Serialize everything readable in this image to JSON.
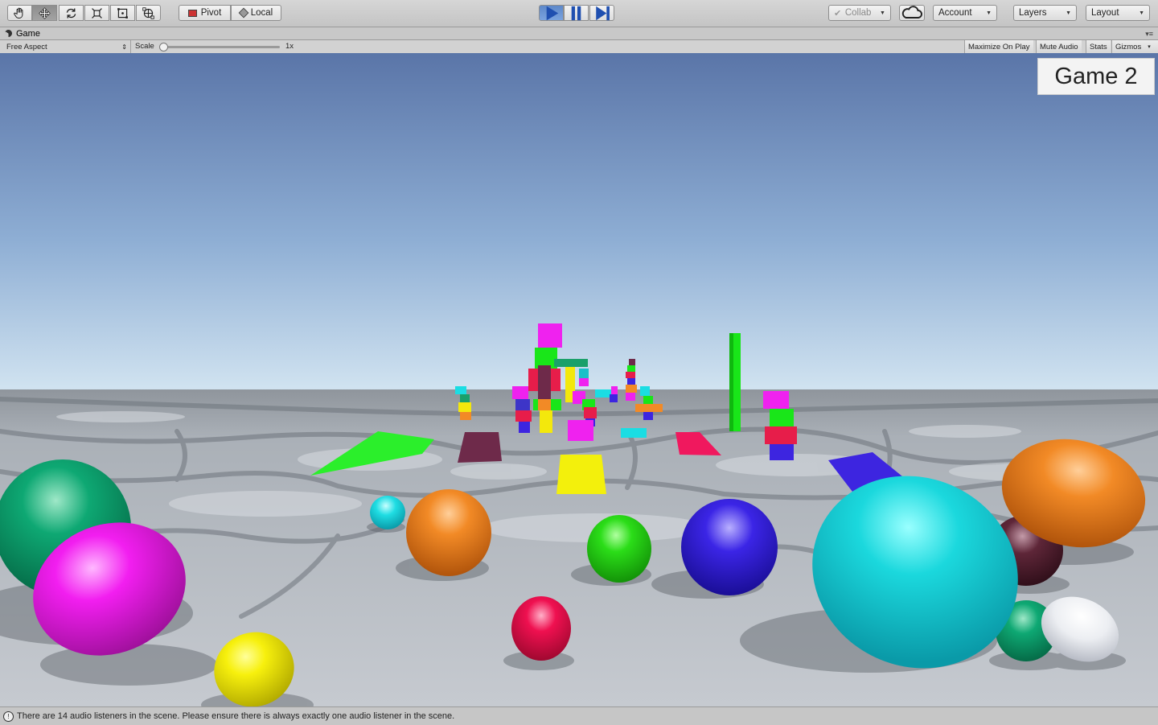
{
  "toolbar": {
    "pivot_label": "Pivot",
    "local_label": "Local",
    "collab_label": "Collab",
    "account_label": "Account",
    "layers_label": "Layers",
    "layout_label": "Layout"
  },
  "tab": {
    "title": "Game"
  },
  "game_controls": {
    "aspect_label": "Free Aspect",
    "scale_label": "Scale",
    "scale_value": "1x",
    "maximize_label": "Maximize On Play",
    "mute_label": "Mute Audio",
    "stats_label": "Stats",
    "gizmos_label": "Gizmos"
  },
  "scene": {
    "overlay_text": "Game 2"
  },
  "status": {
    "message": "There are 14 audio listeners in the scene. Please ensure there is always exactly one audio listener in the scene."
  },
  "colors": {
    "accent_play": "#5d88c9",
    "sky_top": "#5a75a8",
    "sky_horizon": "#d2e4f1",
    "ground": "#bfc4cb"
  }
}
